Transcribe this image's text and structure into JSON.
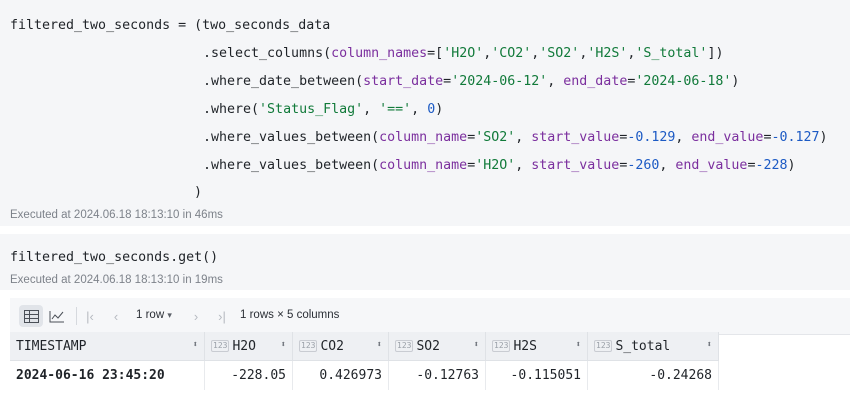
{
  "cell1": {
    "lines": [
      {
        "segments": [
          {
            "t": "filtered_two_seconds = (two_seconds_data",
            "c": "fn"
          }
        ]
      },
      {
        "segments": [
          {
            "t": ".select_columns(",
            "c": "fn"
          },
          {
            "t": "column_names",
            "c": "kw"
          },
          {
            "t": "=[",
            "c": "fn"
          },
          {
            "t": "'H2O'",
            "c": "str"
          },
          {
            "t": ",",
            "c": "fn"
          },
          {
            "t": "'CO2'",
            "c": "str"
          },
          {
            "t": ",",
            "c": "fn"
          },
          {
            "t": "'SO2'",
            "c": "str"
          },
          {
            "t": ",",
            "c": "fn"
          },
          {
            "t": "'H2S'",
            "c": "str"
          },
          {
            "t": ",",
            "c": "fn"
          },
          {
            "t": "'S_total'",
            "c": "str"
          },
          {
            "t": "])",
            "c": "fn"
          }
        ]
      },
      {
        "segments": [
          {
            "t": ".where_date_between(",
            "c": "fn"
          },
          {
            "t": "start_date",
            "c": "kw"
          },
          {
            "t": "=",
            "c": "fn"
          },
          {
            "t": "'2024-06-12'",
            "c": "str"
          },
          {
            "t": ", ",
            "c": "fn"
          },
          {
            "t": "end_date",
            "c": "kw"
          },
          {
            "t": "=",
            "c": "fn"
          },
          {
            "t": "'2024-06-18'",
            "c": "str"
          },
          {
            "t": ")",
            "c": "fn"
          }
        ]
      },
      {
        "segments": [
          {
            "t": ".where(",
            "c": "fn"
          },
          {
            "t": "'Status_Flag'",
            "c": "str"
          },
          {
            "t": ", ",
            "c": "fn"
          },
          {
            "t": "'=='",
            "c": "str"
          },
          {
            "t": ", ",
            "c": "fn"
          },
          {
            "t": "0",
            "c": "num"
          },
          {
            "t": ")",
            "c": "fn"
          }
        ]
      },
      {
        "segments": [
          {
            "t": ".where_values_between(",
            "c": "fn"
          },
          {
            "t": "column_name",
            "c": "kw"
          },
          {
            "t": "=",
            "c": "fn"
          },
          {
            "t": "'SO2'",
            "c": "str"
          },
          {
            "t": ", ",
            "c": "fn"
          },
          {
            "t": "start_value",
            "c": "kw"
          },
          {
            "t": "=",
            "c": "fn"
          },
          {
            "t": "-0.129",
            "c": "num"
          },
          {
            "t": ", ",
            "c": "fn"
          },
          {
            "t": "end_value",
            "c": "kw"
          },
          {
            "t": "=",
            "c": "fn"
          },
          {
            "t": "-0.127",
            "c": "num"
          },
          {
            "t": ")",
            "c": "fn"
          }
        ]
      },
      {
        "segments": [
          {
            "t": ".where_values_between(",
            "c": "fn"
          },
          {
            "t": "column_name",
            "c": "kw"
          },
          {
            "t": "=",
            "c": "fn"
          },
          {
            "t": "'H2O'",
            "c": "str"
          },
          {
            "t": ", ",
            "c": "fn"
          },
          {
            "t": "start_value",
            "c": "kw"
          },
          {
            "t": "=",
            "c": "fn"
          },
          {
            "t": "-260",
            "c": "num"
          },
          {
            "t": ", ",
            "c": "fn"
          },
          {
            "t": "end_value",
            "c": "kw"
          },
          {
            "t": "=",
            "c": "fn"
          },
          {
            "t": "-228",
            "c": "num"
          },
          {
            "t": ")",
            "c": "fn"
          }
        ]
      },
      {
        "segments": [
          {
            "t": ")",
            "c": "fn"
          }
        ]
      }
    ],
    "executed": "Executed at 2024.06.18 18:13:10 in 46ms"
  },
  "cell2": {
    "code": "filtered_two_seconds.get()",
    "executed": "Executed at 2024.06.18 18:13:10 in 19ms"
  },
  "toolbar": {
    "table_view_icon": "table-icon",
    "chart_view_icon": "chart-icon",
    "row_select": "1 row",
    "summary": "1 rows × 5 columns"
  },
  "table": {
    "columns": [
      {
        "name": "TIMESTAMP",
        "type": ""
      },
      {
        "name": "H2O",
        "type": "123"
      },
      {
        "name": "CO2",
        "type": "123"
      },
      {
        "name": "SO2",
        "type": "123"
      },
      {
        "name": "H2S",
        "type": "123"
      },
      {
        "name": "S_total",
        "type": "123"
      }
    ],
    "rows": [
      [
        "2024-06-16 23:45:20",
        "-228.05",
        "0.426973",
        "-0.12763",
        "-0.115051",
        "-0.24268"
      ]
    ]
  }
}
